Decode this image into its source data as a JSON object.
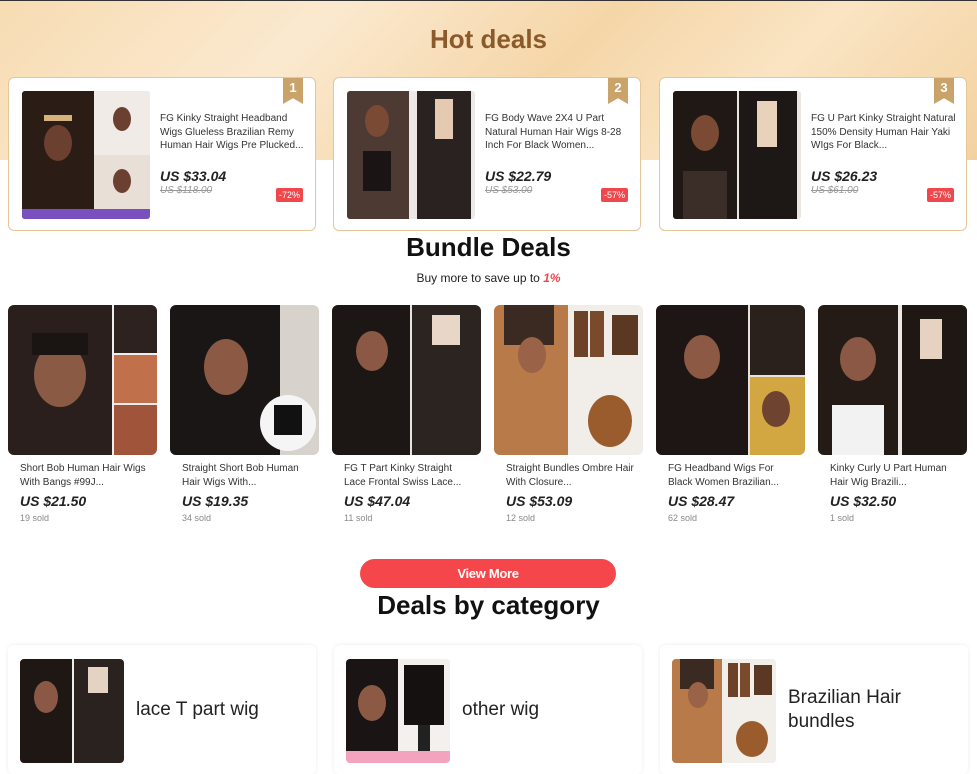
{
  "hot_deals": {
    "title": "Hot deals",
    "items": [
      {
        "rank": "1",
        "name": "FG Kinky Straight Headband Wigs Glueless Brazilian Remy Human Hair Wigs Pre Plucked...",
        "price": "US $33.04",
        "original": "US $118.00",
        "discount": "-72%",
        "image": "headband-wig-photo"
      },
      {
        "rank": "2",
        "name": "FG Body Wave 2X4 U Part Natural Human Hair Wigs 8-28 Inch For Black Women...",
        "price": "US $22.79",
        "original": "US $53.00",
        "discount": "-57%",
        "image": "body-wave-wig-photo"
      },
      {
        "rank": "3",
        "name": "FG U Part Kinky Straight Natural 150% Density Human Hair Yaki WIgs For Black...",
        "price": "US $26.23",
        "original": "US $61.00",
        "discount": "-57%",
        "image": "kinky-straight-wig-photo"
      }
    ]
  },
  "bundle_deals": {
    "title": "Bundle Deals",
    "subtitle": "Buy more to save up to ",
    "percent": "1%",
    "items": [
      {
        "name": "Short Bob Human Hair Wigs With Bangs #99J...",
        "price": "US $21.50",
        "sold": "19 sold"
      },
      {
        "name": "Straight Short Bob Human Hair Wigs With...",
        "price": "US $19.35",
        "sold": "34 sold"
      },
      {
        "name": "FG T Part Kinky Straight Lace Frontal Swiss Lace...",
        "price": "US $47.04",
        "sold": "11 sold"
      },
      {
        "name": "Straight Bundles Ombre Hair With Closure...",
        "price": "US $53.09",
        "sold": "12 sold"
      },
      {
        "name": "FG Headband Wigs For Black Women Brazilian...",
        "price": "US $28.47",
        "sold": "62 sold"
      },
      {
        "name": "Kinky Curly U Part Human Hair Wig Brazili...",
        "price": "US $32.50",
        "sold": "1 sold"
      }
    ],
    "view_more": "View More"
  },
  "categories": {
    "title": "Deals by category",
    "items": [
      {
        "label": "lace T part wig"
      },
      {
        "label": "other wig"
      },
      {
        "label": "Brazilian Hair bundles"
      }
    ]
  },
  "colors": {
    "accent": "#f5474b",
    "hot_title": "#8a5a2b",
    "rank_badge": "#c9a36a"
  }
}
